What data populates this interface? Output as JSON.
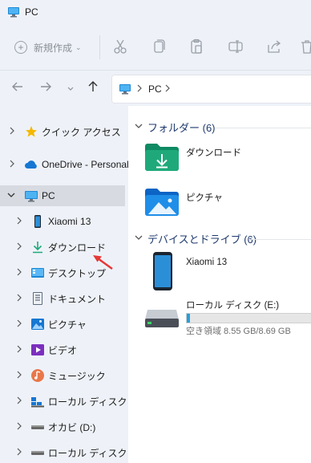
{
  "window": {
    "title": "PC"
  },
  "toolbar": {
    "new_label": "新規作成",
    "new_caret": "⌄"
  },
  "address": {
    "segment": "PC"
  },
  "sidebar": {
    "items": [
      {
        "label": "クイック アクセス",
        "icon": "star-icon"
      },
      {
        "label": "OneDrive - Personal",
        "icon": "cloud-icon"
      },
      {
        "label": "PC",
        "icon": "computer-icon"
      },
      {
        "label": "Xiaomi 13",
        "icon": "phone-icon"
      },
      {
        "label": "ダウンロード",
        "icon": "download-icon"
      },
      {
        "label": "デスクトップ",
        "icon": "desktop-icon"
      },
      {
        "label": "ドキュメント",
        "icon": "document-icon"
      },
      {
        "label": "ピクチャ",
        "icon": "picture-icon"
      },
      {
        "label": "ビデオ",
        "icon": "video-icon"
      },
      {
        "label": "ミュージック",
        "icon": "music-icon"
      },
      {
        "label": "ローカル ディスク (C:)",
        "icon": "drive-c-icon"
      },
      {
        "label": "オカビ (D:)",
        "icon": "drive-icon"
      },
      {
        "label": "ローカル ディスク (E:)",
        "icon": "drive-icon"
      }
    ]
  },
  "content": {
    "folders_header": "フォルダー (6)",
    "folders": [
      {
        "label": "ダウンロード",
        "icon": "download-folder-icon"
      },
      {
        "label": "ピクチャ",
        "icon": "picture-folder-icon"
      }
    ],
    "devices_header": "デバイスとドライブ (6)",
    "devices": [
      {
        "label": "Xiaomi 13",
        "icon": "phone-icon"
      },
      {
        "label": "ローカル ディスク (E:)",
        "icon": "drive-icon",
        "free_text": "空き領域 8.55 GB/8.69 GB",
        "used_fraction": 0.016
      }
    ]
  },
  "colors": {
    "accent": "#26a0da",
    "folder_green": "#1fa97a",
    "folder_blue": "#1f8ee8",
    "annotation_arrow": "#e53935"
  }
}
